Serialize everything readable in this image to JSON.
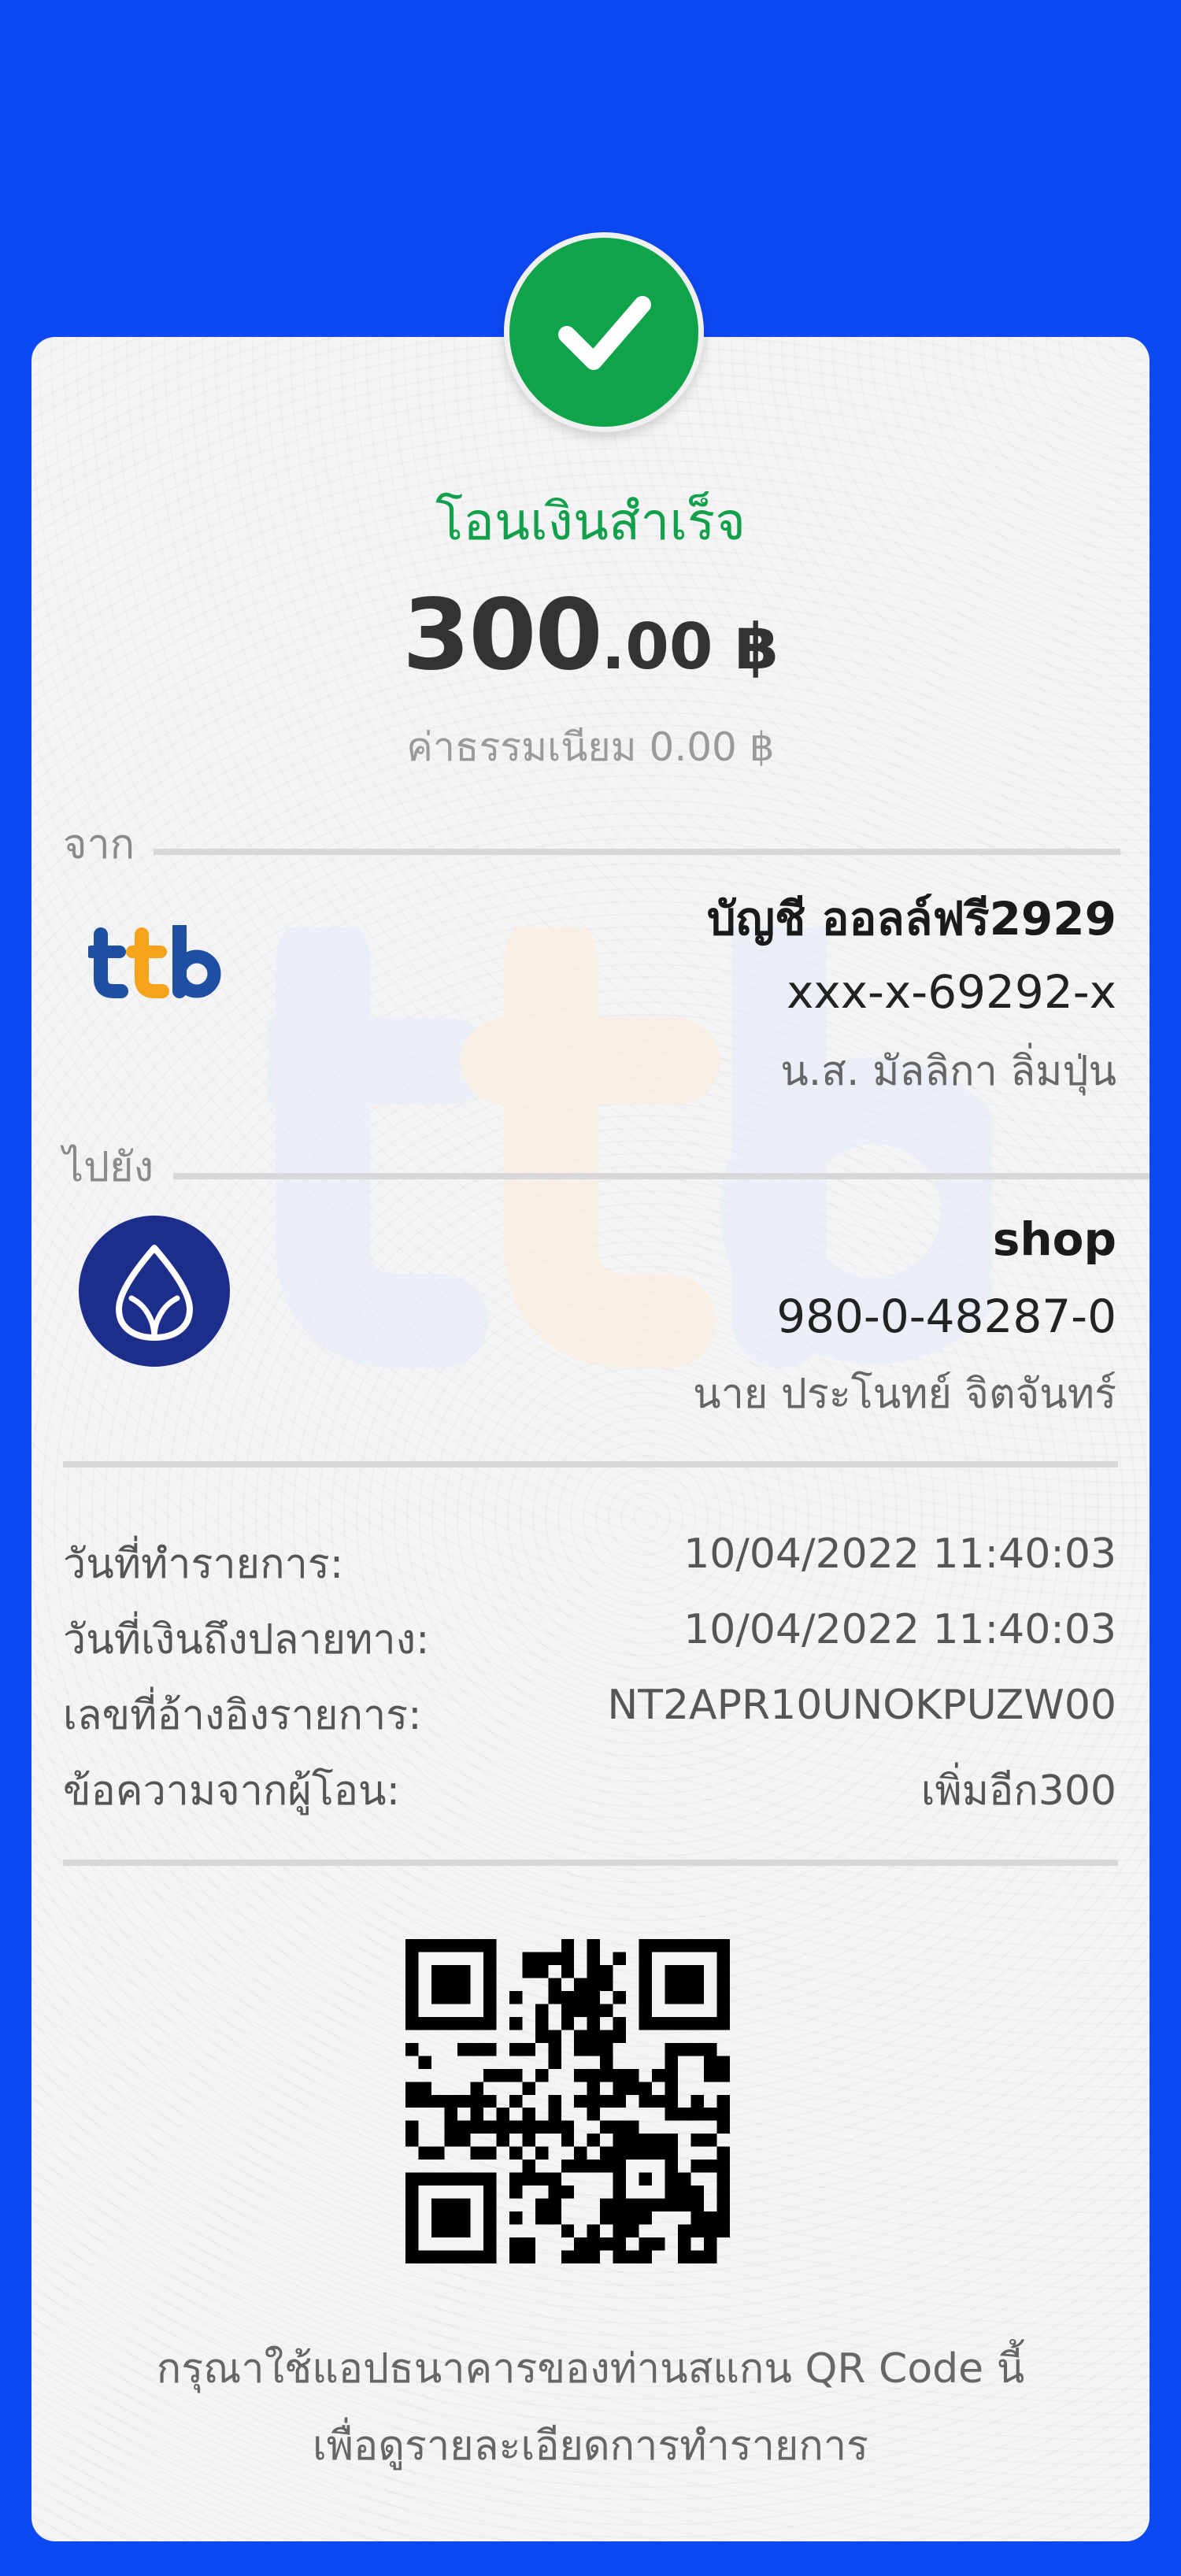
{
  "status": {
    "title": "โอนเงินสำเร็จ",
    "icon": "check-icon"
  },
  "amount": {
    "main": "300",
    "decimals": ".00 ฿"
  },
  "fee": "ค่าธรรมเนียม 0.00 ฿",
  "from": {
    "label": "จาก",
    "bank_logo_text": "ttb",
    "account_name": "บัญชี ออลล์ฟรี2929",
    "account_number": "xxx-x-69292-x",
    "owner": "น.ส. มัลลิกา ลิ่มปุ่น"
  },
  "to": {
    "label": "ไปยัง",
    "account_name": "shop",
    "account_number": "980-0-48287-0",
    "owner": "นาย ประโนทย์ จิตจันทร์"
  },
  "details": [
    {
      "key": "วันที่ทำรายการ:",
      "value": "10/04/2022 11:40:03"
    },
    {
      "key": "วันที่เงินถึงปลายทาง:",
      "value": "10/04/2022 11:40:03"
    },
    {
      "key": "เลขที่อ้างอิงรายการ:",
      "value": "NT2APR10UNOKPUZW00"
    },
    {
      "key": "ข้อความจากผู้โอน:",
      "value": "เพิ่มอีก300"
    }
  ],
  "qr_note": {
    "line1": "กรุณาใช้แอปธนาคารของท่านสแกน QR Code นี้",
    "line2": "เพื่อดูรายละเอียดการทำรายการ"
  },
  "colors": {
    "background": "#0d49f2",
    "success": "#10a44a",
    "ttb_blue": "#1f4fa3",
    "ttb_orange": "#f7a21b",
    "bank_navy": "#1d2d8a"
  }
}
